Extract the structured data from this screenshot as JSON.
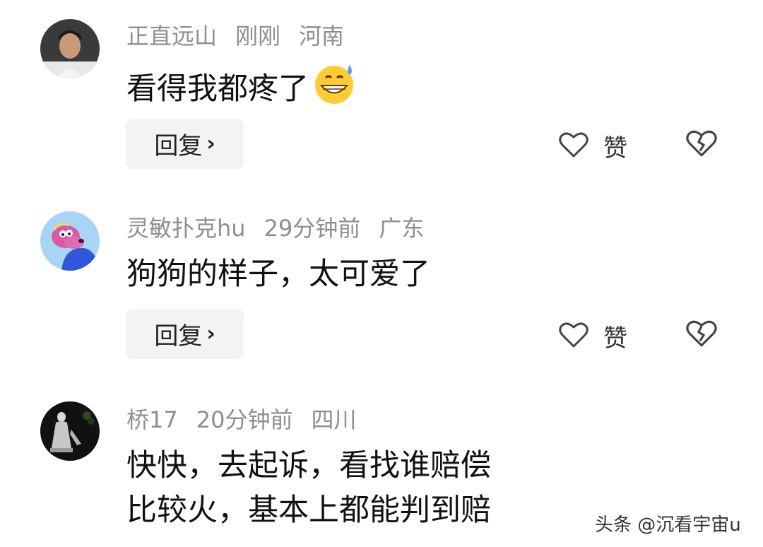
{
  "comments": [
    {
      "username": "正直远山",
      "time": "刚刚",
      "location": "河南",
      "text": "看得我都疼了",
      "emoji_icon": "grinning-sweat-emoji",
      "reply_label": "回复",
      "like_label": "赞"
    },
    {
      "username": "灵敏扑克hu",
      "time": "29分钟前",
      "location": "广东",
      "text": "狗狗的样子，太可爱了",
      "reply_label": "回复",
      "like_label": "赞"
    },
    {
      "username": "桥17",
      "time": "20分钟前",
      "location": "四川",
      "text_line1": "快快，去起诉，看找谁赔偿",
      "text_line2": "比较火，基本上都能判到赔"
    }
  ],
  "watermark": "头条 @沉看宇宙u",
  "icons": {
    "reply_chevron": "chevron-right-icon",
    "like": "heart-icon",
    "dislike": "broken-heart-icon"
  },
  "colors": {
    "meta_text": "#8e8e93",
    "body_text": "#111111",
    "button_bg": "#f3f3f5"
  }
}
